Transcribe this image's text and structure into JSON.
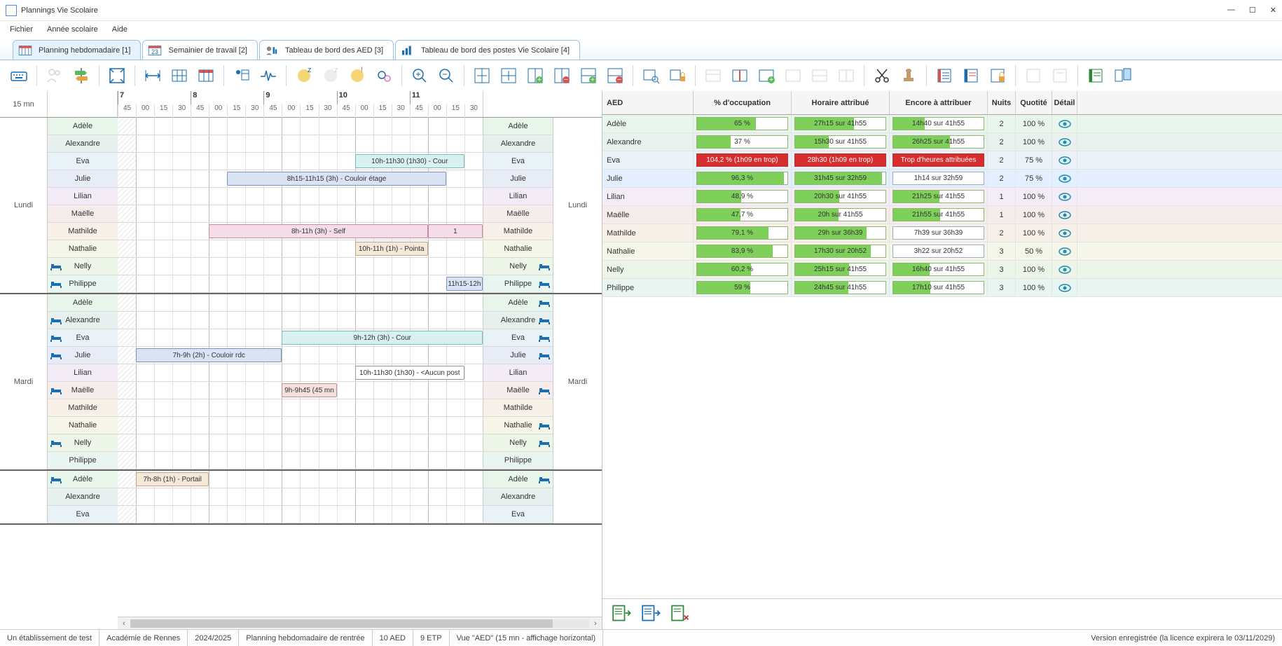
{
  "window": {
    "title": "Plannings Vie Scolaire"
  },
  "menu": {
    "file": "Fichier",
    "year": "Année scolaire",
    "help": "Aide"
  },
  "tabs": [
    {
      "icon": "calendar-week",
      "label": "Planning hebdomadaire [1]"
    },
    {
      "icon": "calendar-day",
      "label": "Semainier de travail [2]"
    },
    {
      "icon": "dashboard-user",
      "label": "Tableau de bord des AED [3]"
    },
    {
      "icon": "dashboard-chart",
      "label": "Tableau de bord des postes Vie Scolaire [4]"
    }
  ],
  "time_header": {
    "resolution": "15 mn",
    "hours": [
      "7",
      "8",
      "9",
      "10",
      "11"
    ],
    "quarters": [
      "45",
      "00",
      "15",
      "30",
      "45",
      "00",
      "15",
      "30",
      "45",
      "00",
      "15",
      "30",
      "45",
      "00",
      "15",
      "30",
      "45",
      "00",
      "15",
      "30"
    ]
  },
  "people": [
    "Adèle",
    "Alexandre",
    "Eva",
    "Julie",
    "Lilian",
    "Maëlle",
    "Mathilde",
    "Nathalie",
    "Nelly",
    "Philippe"
  ],
  "days": [
    {
      "name": "Lundi",
      "beds_left": {
        "Nelly": true,
        "Philippe": true
      },
      "beds_right": {
        "Nelly": true,
        "Philippe": true
      },
      "events": [
        {
          "person": "Eva",
          "label": "10h-11h30 (1h30) - Cour",
          "start": 13,
          "span": 6,
          "cls": "teal"
        },
        {
          "person": "Julie",
          "label": "8h15-11h15 (3h) - Couloir étage",
          "start": 6,
          "span": 12,
          "cls": "blue"
        },
        {
          "person": "Mathilde",
          "label": "8h-11h (3h) - Self",
          "start": 5,
          "span": 12,
          "cls": "pink"
        },
        {
          "person": "Mathilde",
          "label": "1",
          "start": 17,
          "span": 3,
          "cls": "pink",
          "edge": true
        },
        {
          "person": "Nathalie",
          "label": "10h-11h (1h) - Pointa",
          "start": 13,
          "span": 4,
          "cls": "peach"
        },
        {
          "person": "Philippe",
          "label": "11h15-12h",
          "start": 18,
          "span": 2,
          "cls": "blue",
          "edge": true
        }
      ]
    },
    {
      "name": "Mardi",
      "beds_left": {
        "Alexandre": true,
        "Eva": true,
        "Julie": true,
        "Maëlle": true,
        "Nelly": true
      },
      "beds_right": {
        "Adèle": true,
        "Alexandre": true,
        "Eva": true,
        "Julie": true,
        "Maëlle": true,
        "Nathalie": true,
        "Nelly": true
      },
      "events": [
        {
          "person": "Eva",
          "label": "9h-12h (3h) - Cour",
          "start": 9,
          "span": 11,
          "cls": "teal",
          "edge": true
        },
        {
          "person": "Julie",
          "label": "7h-9h (2h) - Couloir rdc",
          "start": 1,
          "span": 8,
          "cls": "blue"
        },
        {
          "person": "Lilian",
          "label": "10h-11h30 (1h30) - <Aucun post",
          "start": 13,
          "span": 6,
          "cls": "white"
        },
        {
          "person": "Maëlle",
          "label": "9h-9h45 (45 mn",
          "start": 9,
          "span": 3,
          "cls": "salmon"
        }
      ]
    },
    {
      "name": "",
      "partial": true,
      "beds_left": {
        "Adèle": true
      },
      "beds_right": {
        "Adèle": true
      },
      "events": [
        {
          "person": "Adèle",
          "label": "7h-8h (1h) - Portail",
          "start": 1,
          "span": 4,
          "cls": "peach"
        }
      ],
      "rows_shown": [
        "Adèle",
        "Alexandre",
        "Eva"
      ]
    }
  ],
  "right_table": {
    "headers": {
      "aed": "AED",
      "occ": "% d'occupation",
      "hor": "Horaire attribué",
      "enc": "Encore à attribuer",
      "nui": "Nuits",
      "quo": "Quotité",
      "det": "Détail"
    },
    "rows": [
      {
        "aed": "Adèle",
        "occ": "65 %",
        "occ_pct": 65,
        "hor": "27h15 sur 41h55",
        "hor_pct": 65,
        "enc": "14h40 sur 41h55",
        "enc_pct": 35,
        "nui": "2",
        "quo": "100 %"
      },
      {
        "aed": "Alexandre",
        "occ": "37 %",
        "occ_pct": 37,
        "hor": "15h30 sur 41h55",
        "hor_pct": 37,
        "enc": "26h25 sur 41h55",
        "enc_pct": 63,
        "nui": "2",
        "quo": "100 %"
      },
      {
        "aed": "Eva",
        "occ": "104,2 % (1h09 en trop)",
        "occ_red": true,
        "hor": "28h30 (1h09 en trop)",
        "hor_red": true,
        "enc": "Trop d'heures attribuées",
        "enc_red": true,
        "nui": "2",
        "quo": "75 %"
      },
      {
        "aed": "Julie",
        "occ": "96,3 %",
        "occ_pct": 96,
        "hor": "31h45 sur 32h59",
        "hor_pct": 96,
        "enc": "1h14 sur 32h59",
        "enc_plain": true,
        "nui": "2",
        "quo": "75 %",
        "sel": true
      },
      {
        "aed": "Lilian",
        "occ": "48,9 %",
        "occ_pct": 49,
        "hor": "20h30 sur 41h55",
        "hor_pct": 49,
        "enc": "21h25 sur 41h55",
        "enc_pct": 51,
        "nui": "1",
        "quo": "100 %"
      },
      {
        "aed": "Maëlle",
        "occ": "47,7 %",
        "occ_pct": 48,
        "hor": "20h sur 41h55",
        "hor_pct": 48,
        "enc": "21h55 sur 41h55",
        "enc_pct": 52,
        "nui": "1",
        "quo": "100 %"
      },
      {
        "aed": "Mathilde",
        "occ": "79,1 %",
        "occ_pct": 79,
        "hor": "29h sur 36h39",
        "hor_pct": 79,
        "enc": "7h39 sur 36h39",
        "enc_plain": true,
        "nui": "2",
        "quo": "100 %"
      },
      {
        "aed": "Nathalie",
        "occ": "83,9 %",
        "occ_pct": 84,
        "hor": "17h30 sur 20h52",
        "hor_pct": 84,
        "enc": "3h22 sur 20h52",
        "enc_plain": true,
        "nui": "3",
        "quo": "50 %"
      },
      {
        "aed": "Nelly",
        "occ": "60,2 %",
        "occ_pct": 60,
        "hor": "25h15 sur 41h55",
        "hor_pct": 60,
        "enc": "16h40 sur 41h55",
        "enc_pct": 40,
        "nui": "3",
        "quo": "100 %"
      },
      {
        "aed": "Philippe",
        "occ": "59 %",
        "occ_pct": 59,
        "hor": "24h45 sur 41h55",
        "hor_pct": 59,
        "enc": "17h10 sur 41h55",
        "enc_pct": 41,
        "nui": "3",
        "quo": "100 %"
      }
    ]
  },
  "status": {
    "cells": [
      "Un établissement de test",
      "Académie de Rennes",
      "2024/2025",
      "Planning hebdomadaire de rentrée",
      "10 AED",
      "9 ETP",
      "Vue \"AED\" (15 mn - affichage horizontal)"
    ],
    "right": "Version enregistrée (la licence expirera le 03/11/2029)"
  }
}
